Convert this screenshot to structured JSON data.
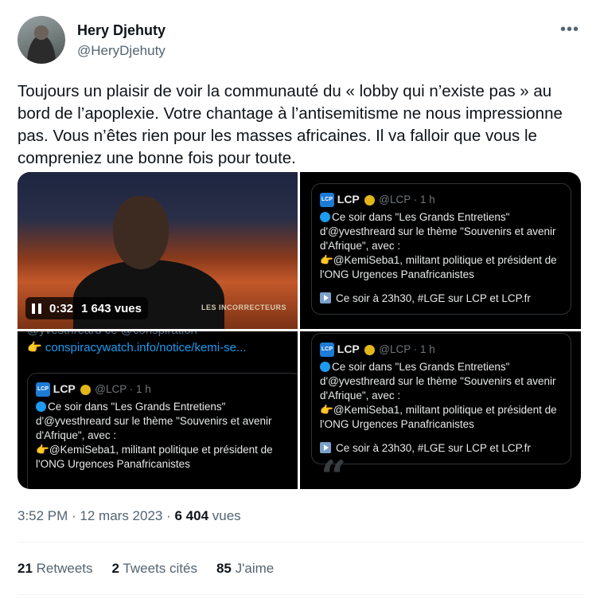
{
  "author": {
    "name": "Hery Djehuty",
    "handle": "@HeryDjehuty",
    "more_icon": "more-horizontal-icon"
  },
  "tweet": {
    "text": "Toujours un plaisir de voir la communauté du « lobby qui n’existe pas » au bord de l’apoplexie. Votre chantage à l’antisemitisme ne nous impressionne pas. Vous n’êtes rien pour les masses africaines. Il va falloir que vous le compreniez une bonne fois pour toute."
  },
  "media": {
    "video": {
      "duration": "0:32",
      "views": "1 643 vues",
      "watermark": "LES INCORRECTEURS"
    },
    "embedded_tweet": {
      "logo": "LCP",
      "name": "LCP",
      "handle_time": "@LCP · 1 h",
      "line1": "Ce soir dans \"Les Grands Entretiens\" d'@yvesthreard sur le thème \"Souvenirs et avenir d'Afrique\", avec :",
      "line2": "@KemiSeba1, militant politique et président de l'ONG Urgences Panafricanistes",
      "line3": "Ce soir à 23h30, #LGE sur LCP et LCP.fr"
    },
    "cell3": {
      "clipped": "@yvesthreard ce @conspiration",
      "link": "conspiracywatch.info/notice/kemi-se..."
    }
  },
  "timestamp": {
    "time": "3:52 PM",
    "sep1": " · ",
    "date": "12 mars 2023",
    "sep2": " · ",
    "views_count": "6 404",
    "views_label": "vues"
  },
  "stats": {
    "retweets_count": "21",
    "retweets_label": "Retweets",
    "quotes_count": "2",
    "quotes_label": "Tweets cités",
    "likes_count": "85",
    "likes_label": "J'aime"
  },
  "colors": {
    "text": "#0f1419",
    "secondary": "#536471",
    "link": "#1d9bf0",
    "dark_bg": "#000000"
  }
}
